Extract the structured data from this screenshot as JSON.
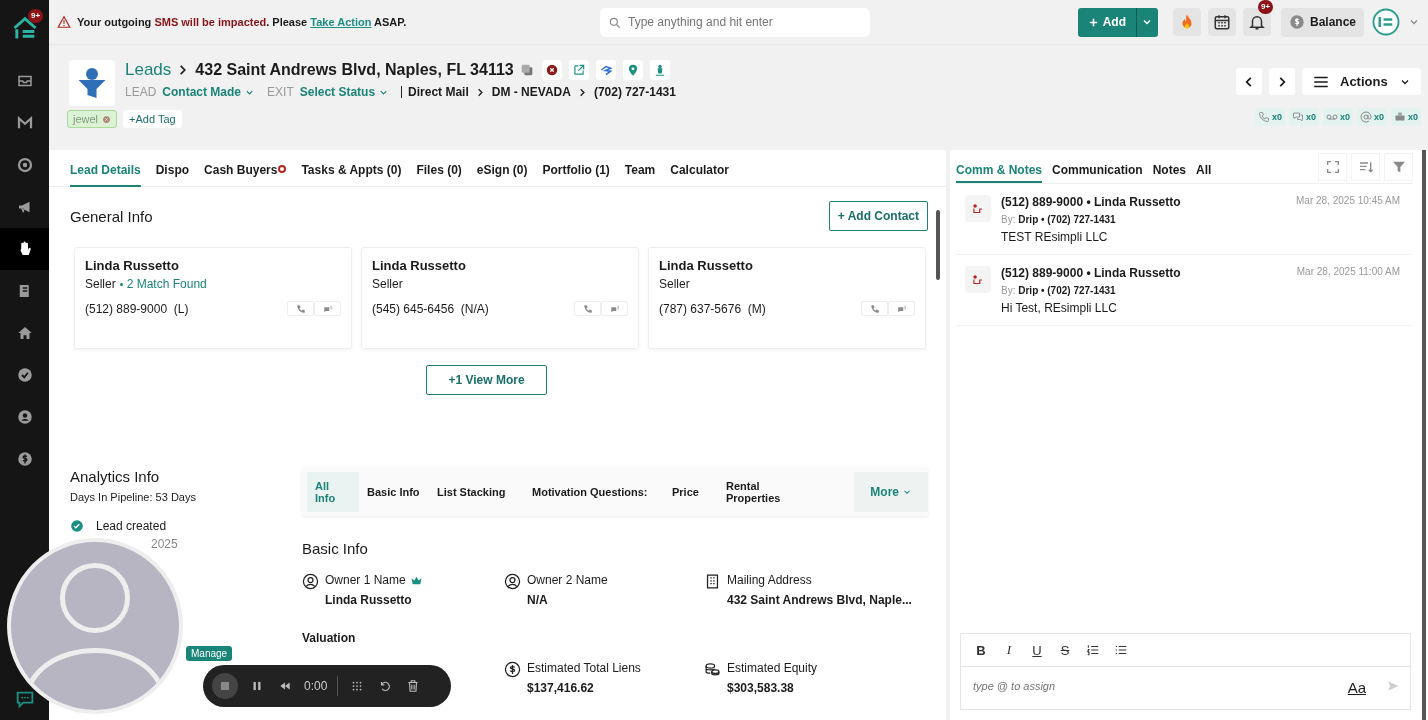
{
  "sidebar": {
    "badge": "9+",
    "items": [
      {
        "kind": "inbox",
        "selected": false
      },
      {
        "kind": "mail",
        "selected": false
      },
      {
        "kind": "target",
        "selected": false
      },
      {
        "kind": "megaphone",
        "selected": false
      },
      {
        "kind": "hand",
        "selected": true
      },
      {
        "kind": "book",
        "selected": false
      },
      {
        "kind": "home",
        "selected": false
      },
      {
        "kind": "check",
        "selected": false
      },
      {
        "kind": "user",
        "selected": false
      },
      {
        "kind": "dollar",
        "selected": false
      }
    ]
  },
  "banner": {
    "parts": [
      {
        "kind": "plain",
        "text": "Your outgoing "
      },
      {
        "kind": "alert",
        "text": "SMS will be impacted"
      },
      {
        "kind": "plain",
        "text": ". Please "
      },
      {
        "kind": "link",
        "text": "Take Action"
      },
      {
        "kind": "plain",
        "text": " ASAP."
      }
    ]
  },
  "search": {
    "placeholder": "Type anything and hit enter"
  },
  "add_button": "Add",
  "notifications_badge": "9+",
  "balance": "Balance",
  "header": {
    "breadcrumb": "Leads",
    "title": "432 Saint Andrews Blvd, Naples, FL 34113",
    "lead_label": "LEAD",
    "lead_status": "Contact Made",
    "exit_label": "EXIT",
    "exit_status": "Select Status",
    "path": [
      "Direct Mail",
      "DM - NEVADA",
      "(702) 727-1431"
    ],
    "tags": [
      {
        "label": "jewel"
      }
    ],
    "add_tag": "+Add Tag",
    "actions": "Actions",
    "counters": [
      {
        "kind": "phone",
        "count": "x0"
      },
      {
        "kind": "sms",
        "count": "x0"
      },
      {
        "kind": "voicemail",
        "count": "x0"
      },
      {
        "kind": "email",
        "count": "x0"
      },
      {
        "kind": "fax",
        "count": "x0"
      }
    ]
  },
  "tabs": [
    {
      "label": "Lead Details",
      "selected": true,
      "dot": false
    },
    {
      "label": "Dispo",
      "selected": false,
      "dot": false
    },
    {
      "label": "Cash Buyers",
      "selected": false,
      "dot": true
    },
    {
      "label": "Tasks & Appts (0)",
      "selected": false,
      "dot": false
    },
    {
      "label": "Files (0)",
      "selected": false,
      "dot": false
    },
    {
      "label": "eSign (0)",
      "selected": false,
      "dot": false
    },
    {
      "label": "Portfolio (1)",
      "selected": false,
      "dot": false
    },
    {
      "label": "Team",
      "selected": false,
      "dot": false
    },
    {
      "label": "Calculator",
      "selected": false,
      "dot": false
    }
  ],
  "general_info": {
    "title": "General Info",
    "add_contact": "+ Add Contact",
    "view_more": "+1 View More",
    "contacts": [
      {
        "name": "Linda Russetto",
        "role": "Seller",
        "match": "2 Match Found",
        "phone": "(512) 889-9000  (L)"
      },
      {
        "name": "Linda Russetto",
        "role": "Seller",
        "phone": "(545) 645-6456  (N/A)"
      },
      {
        "name": "Linda Russetto",
        "role": "Seller",
        "phone": "(787) 637-5676  (M)"
      }
    ]
  },
  "analytics": {
    "title": "Analytics Info",
    "days": "Days In Pipeline: 53 Days",
    "events": [
      {
        "label": "Lead created",
        "date": "2025",
        "done": true
      }
    ],
    "badge": "Manage"
  },
  "info_tabs": {
    "items": [
      {
        "label": "All Info",
        "selected": true
      },
      {
        "label": "Basic Info",
        "selected": false
      },
      {
        "label": "List Stacking",
        "selected": false
      },
      {
        "label": "Motivation Questions:",
        "selected": false
      },
      {
        "label": "Price",
        "selected": false
      },
      {
        "label": "Rental Properties",
        "selected": false
      }
    ],
    "more": "More"
  },
  "basic_info": {
    "title": "Basic Info",
    "fields": [
      {
        "kind": "person",
        "label": "Owner 1 Name",
        "crown": true,
        "value": "Linda Russetto"
      },
      {
        "kind": "person",
        "label": "Owner 2 Name",
        "crown": false,
        "value": "N/A"
      },
      {
        "kind": "building",
        "label": "Mailing Address",
        "crown": false,
        "value": "432 Saint Andrews Blvd, Naple..."
      }
    ],
    "valuation_title": "Valuation",
    "valuation": [
      {
        "kind": "dollar",
        "label": "Estimated Total Liens",
        "value": "$137,416.62"
      },
      {
        "kind": "coins",
        "label": "Estimated Equity",
        "value": "$303,583.38"
      }
    ]
  },
  "comm": {
    "tabs": [
      {
        "label": "Comm & Notes",
        "selected": true
      },
      {
        "label": "Communication",
        "selected": false
      },
      {
        "label": "Notes",
        "selected": false
      },
      {
        "label": "All",
        "selected": false
      }
    ],
    "messages": [
      {
        "title": "(512) 889-9000 • Linda Russetto",
        "by_label": "By:",
        "by": "Drip • (702) 727-1431",
        "text": "TEST REsimpli LLC",
        "time": "Mar 28, 2025 10:45 AM"
      },
      {
        "title": "(512) 889-9000 • Linda Russetto",
        "by_label": "By:",
        "by": "Drip • (702) 727-1431",
        "text": "Hi Test, REsimpli LLC",
        "time": "Mar 28, 2025 11:00 AM"
      }
    ],
    "toolbar": [
      {
        "kind": "bold",
        "label": "B"
      },
      {
        "kind": "italic",
        "label": "I"
      },
      {
        "kind": "underline",
        "label": "U"
      },
      {
        "kind": "strike",
        "label": "S"
      },
      {
        "kind": "ordered-list"
      },
      {
        "kind": "bullet-list"
      }
    ],
    "placeholder": "type @ to assign",
    "format": "Aa"
  },
  "recorder": {
    "time": "0:00"
  }
}
